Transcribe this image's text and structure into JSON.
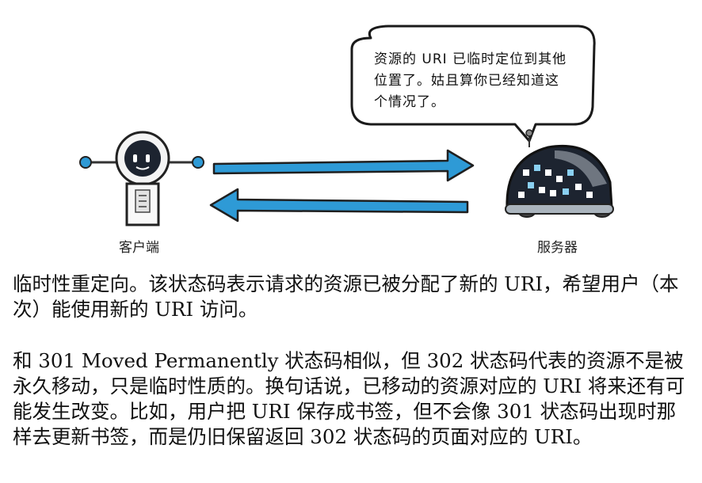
{
  "illustration": {
    "client_label": "客户端",
    "server_label": "服务器",
    "speech_bubble": "资源的 URI 已临时定位到其他位置了。姑且算你已经知道这个情况了。",
    "arrow_color": "#2e9ad6",
    "robot_color": "#1d2430"
  },
  "body": {
    "paragraph_1": "临时性重定向。该状态码表示请求的资源已被分配了新的 URI，希望用户（本次）能使用新的 URI 访问。",
    "paragraph_2": "和 301 Moved Permanently 状态码相似，但 302 状态码代表的资源不是被永久移动，只是临时性质的。换句话说，已移动的资源对应的 URI 将来还有可能发生改变。比如，用户把 URI 保存成书签，但不会像 301 状态码出现时那样去更新书签，而是仍旧保留返回 302 状态码的页面对应的 URI。"
  }
}
